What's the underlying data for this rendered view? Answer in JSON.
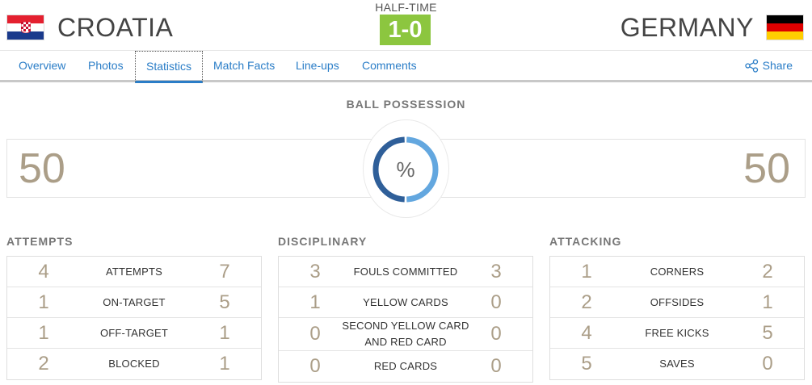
{
  "header": {
    "home_team": "CROATIA",
    "away_team": "GERMANY",
    "status": "HALF-TIME",
    "score": "1-0",
    "score_color": "#8cc63f"
  },
  "nav": {
    "tabs": [
      {
        "label": "Overview",
        "active": false
      },
      {
        "label": "Photos",
        "active": false
      },
      {
        "label": "Statistics",
        "active": true
      },
      {
        "label": "Match Facts",
        "active": false
      },
      {
        "label": "Line-ups",
        "active": false
      },
      {
        "label": "Comments",
        "active": false
      }
    ],
    "share_label": "Share",
    "share_icon": "share-icon",
    "link_color": "#2a7dc7"
  },
  "possession": {
    "title": "BALL POSSESSION",
    "home": "50",
    "away": "50",
    "unit": "%",
    "home_fraction": 0.5,
    "home_color": "#2f5f99",
    "away_color": "#63a7df"
  },
  "sections": [
    {
      "title": "ATTEMPTS",
      "rows": [
        {
          "label": "ATTEMPTS",
          "home": "4",
          "away": "7"
        },
        {
          "label": "ON-TARGET",
          "home": "1",
          "away": "5"
        },
        {
          "label": "OFF-TARGET",
          "home": "1",
          "away": "1"
        },
        {
          "label": "BLOCKED",
          "home": "2",
          "away": "1"
        }
      ]
    },
    {
      "title": "DISCIPLINARY",
      "rows": [
        {
          "label": "FOULS COMMITTED",
          "home": "3",
          "away": "3"
        },
        {
          "label": "YELLOW CARDS",
          "home": "1",
          "away": "0"
        },
        {
          "label": "SECOND YELLOW CARD AND RED CARD",
          "home": "0",
          "away": "0"
        },
        {
          "label": "RED CARDS",
          "home": "0",
          "away": "0"
        }
      ]
    },
    {
      "title": "ATTACKING",
      "rows": [
        {
          "label": "CORNERS",
          "home": "1",
          "away": "2"
        },
        {
          "label": "OFFSIDES",
          "home": "2",
          "away": "1"
        },
        {
          "label": "FREE KICKS",
          "home": "4",
          "away": "5"
        },
        {
          "label": "SAVES",
          "home": "5",
          "away": "0"
        }
      ]
    }
  ],
  "value_color": "#ab9e88"
}
